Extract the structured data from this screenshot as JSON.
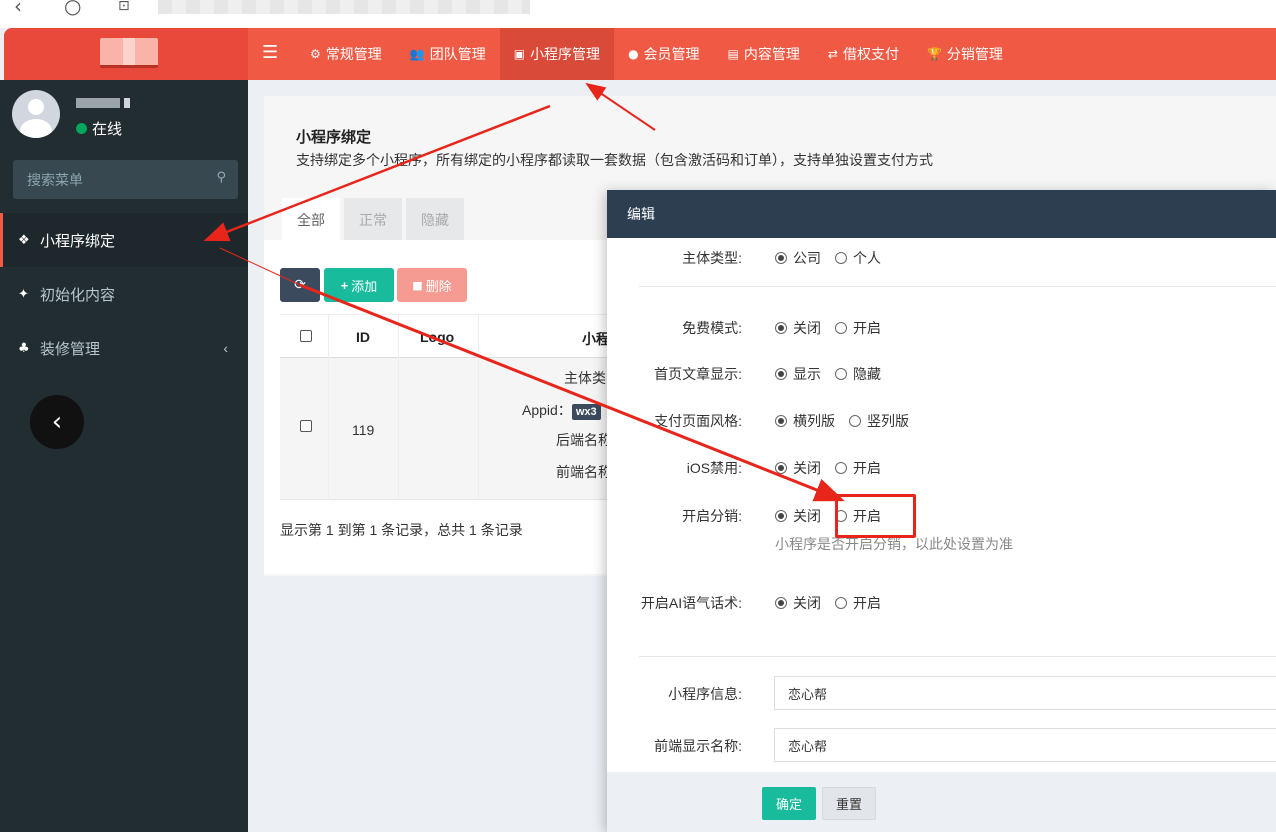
{
  "header": {
    "nav": [
      {
        "icon": "⚙",
        "label": "常规管理",
        "active": false
      },
      {
        "icon": "👥",
        "label": "团队管理",
        "active": false
      },
      {
        "icon": "▣",
        "label": "小程序管理",
        "active": true
      },
      {
        "icon": "●",
        "label": "会员管理",
        "active": false
      },
      {
        "icon": "▤",
        "label": "内容管理",
        "active": false
      },
      {
        "icon": "⇄",
        "label": "借权支付",
        "active": false
      },
      {
        "icon": "🏆",
        "label": "分销管理",
        "active": false
      }
    ]
  },
  "sidebar": {
    "status": "在线",
    "search_placeholder": "搜索菜单",
    "items": [
      {
        "label": "小程序绑定",
        "active": true
      },
      {
        "label": "初始化内容",
        "active": false
      },
      {
        "label": "装修管理",
        "active": false
      }
    ]
  },
  "page": {
    "title": "小程序绑定",
    "desc": "支持绑定多个小程序，所有绑定的小程序都读取一套数据（包含激活码和订单），支持单独设置支付方式",
    "tabs": [
      "全部",
      "正常",
      "隐藏"
    ]
  },
  "toolbar": {
    "add": "添加",
    "delete": "删除"
  },
  "table": {
    "headers": [
      "ID",
      "Logo",
      "小程"
    ],
    "row": {
      "id": "119",
      "line1": "主体类",
      "line2_label": "Appid：",
      "line2_tag": "wx3",
      "line3": "后端名称",
      "line4": "前端名称"
    },
    "footer": "显示第 1 到第 1 条记录，总共 1 条记录"
  },
  "modal": {
    "title": "编辑",
    "fields": {
      "subject_type": {
        "label": "主体类型:",
        "options": [
          "公司",
          "个人"
        ],
        "selected": 0
      },
      "free_mode": {
        "label": "免费模式:",
        "options": [
          "关闭",
          "开启"
        ],
        "selected": 0
      },
      "home_article": {
        "label": "首页文章显示:",
        "options": [
          "显示",
          "隐藏"
        ],
        "selected": 0
      },
      "pay_style": {
        "label": "支付页面风格:",
        "options": [
          "横列版",
          "竖列版"
        ],
        "selected": 0
      },
      "ios_disable": {
        "label": "iOS禁用:",
        "options": [
          "关闭",
          "开启"
        ],
        "selected": 0
      },
      "distribution": {
        "label": "开启分销:",
        "options": [
          "关闭",
          "开启"
        ],
        "selected": 0,
        "hint": "小程序是否开启分销，以此处设置为准"
      },
      "ai_tone": {
        "label": "开启AI语气话术:",
        "options": [
          "关闭",
          "开启"
        ],
        "selected": 0
      },
      "mini_info": {
        "label": "小程序信息:",
        "value": "恋心帮"
      },
      "front_name": {
        "label": "前端显示名称:",
        "value": "恋心帮"
      }
    },
    "confirm": "确定",
    "reset": "重置"
  },
  "annotation_color": "#e8251b"
}
